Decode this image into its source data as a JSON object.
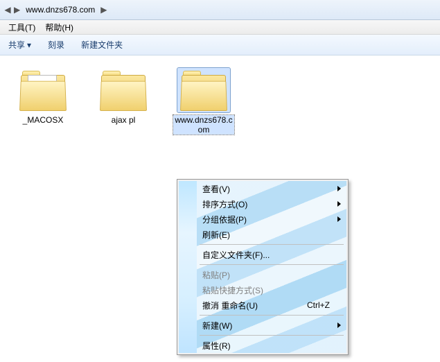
{
  "addressbar": {
    "path_segment": "www.dnzs678.com"
  },
  "menubar": {
    "tools": "工具(T)",
    "help": "帮助(H)"
  },
  "toolbar": {
    "share": "共享",
    "burn": "刻录",
    "newfolder": "新建文件夹"
  },
  "folders": [
    {
      "name": "_MACOSX",
      "variant": "doc"
    },
    {
      "name": "ajax pl",
      "variant": "ie"
    },
    {
      "name": "www.dnzs678.com",
      "variant": "plain"
    }
  ],
  "contextmenu": {
    "view": "查看(V)",
    "sort": "排序方式(O)",
    "group": "分组依据(P)",
    "refresh": "刷新(E)",
    "customize": "自定义文件夹(F)...",
    "paste": "粘贴(P)",
    "paste_shortcut": "粘贴快捷方式(S)",
    "undo_rename": "撤消 重命名(U)",
    "undo_shortcut": "Ctrl+Z",
    "new": "新建(W)",
    "properties": "属性(R)"
  }
}
